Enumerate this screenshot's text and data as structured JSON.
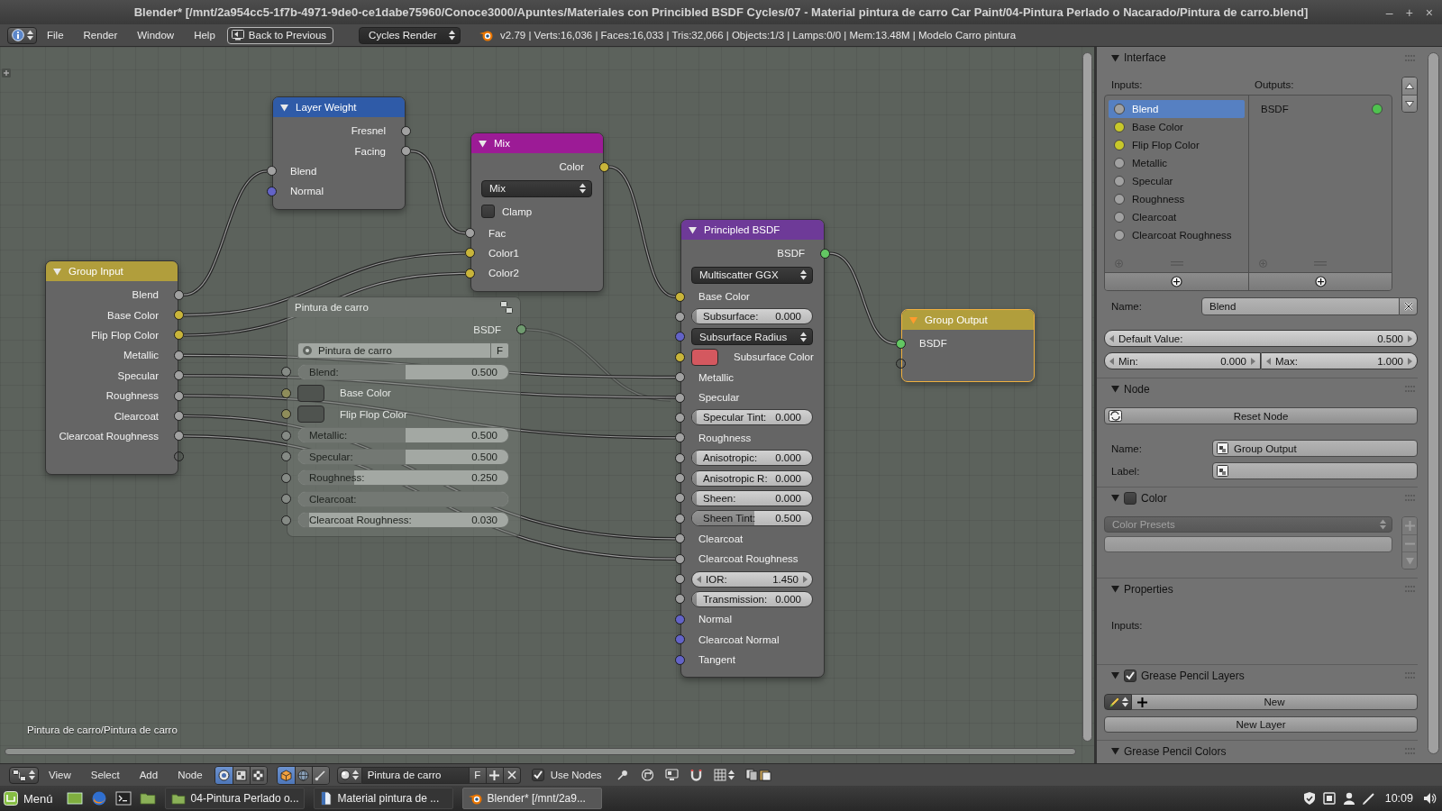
{
  "window": {
    "title": "Blender* [/mnt/2a954cc5-1f7b-4971-9de0-ce1dabe75960/Conoce3000/Apuntes/Materiales con Princibled BSDF Cycles/07 - Material pintura de carro Car Paint/04-Pintura Perlado o Nacarado/Pintura de carro.blend]",
    "controls": [
      "–",
      "+",
      "×"
    ]
  },
  "info_header": {
    "menus": [
      "File",
      "Render",
      "Window",
      "Help"
    ],
    "back_button": "Back to Previous",
    "render_engine": "Cycles Render",
    "stats": "v2.79 | Verts:16,036 | Faces:16,033 | Tris:32,066 | Objects:1/3 | Lamps:0/0 | Mem:13.48M | Modelo Carro pintura"
  },
  "node_editor": {
    "background_node": {
      "title": "Pintura de carro",
      "rows": [
        {
          "kind": "output",
          "label": "BSDF",
          "color": "#6f9a6f"
        },
        {
          "kind": "node_group",
          "label": "Pintura de carro",
          "fake_user": "F"
        },
        {
          "kind": "slider",
          "label": "Blend:",
          "value": "0.500",
          "level": 0.5,
          "color": "#858a85"
        },
        {
          "kind": "swatch",
          "label": "Base Color",
          "color": "#8f8d5a",
          "swatch": {
            "color": "#4f534f"
          }
        },
        {
          "kind": "swatch",
          "label": "Flip Flop Color",
          "color": "#8f8d5a",
          "swatch": {
            "color": "#4f534f"
          }
        },
        {
          "kind": "slider",
          "label": "Metallic:",
          "value": "0.500",
          "level": 0.5,
          "color": "#858a85"
        },
        {
          "kind": "slider",
          "label": "Specular:",
          "value": "0.500",
          "level": 0.5,
          "color": "#858a85"
        },
        {
          "kind": "slider",
          "label": "Roughness:",
          "value": "0.250",
          "level": 0.25,
          "color": "#858a85"
        },
        {
          "kind": "slider",
          "label": "Clearcoat:",
          "level": 1,
          "color": "#858a85"
        },
        {
          "kind": "slider",
          "label": "Clearcoat Roughness:",
          "value": "0.030",
          "level": 0.03,
          "color": "#858a85"
        }
      ]
    },
    "nodes": [
      {
        "title": "Layer Weight",
        "color": "#2f5ba8",
        "selected": false,
        "rows": [
          {
            "kind": "output",
            "label": "Fresnel",
            "color": "#a1a1a1"
          },
          {
            "kind": "output",
            "label": "Facing",
            "color": "#a1a1a1"
          },
          {
            "kind": "input",
            "label": "Blend",
            "color": "#a1a1a1"
          },
          {
            "kind": "input",
            "label": "Normal",
            "color": "#6363c7"
          }
        ]
      },
      {
        "title": "Mix",
        "color": "#9c1b96",
        "selected": false,
        "rows": [
          {
            "kind": "output",
            "label": "Color",
            "color": "#c9b53a"
          },
          {
            "kind": "menu",
            "label": "Mix"
          },
          {
            "kind": "checkbox",
            "label": "Clamp",
            "checked": false
          },
          {
            "kind": "input",
            "label": "Fac",
            "color": "#a1a1a1"
          },
          {
            "kind": "input",
            "label": "Color1",
            "color": "#c9b53a"
          },
          {
            "kind": "input",
            "label": "Color2",
            "color": "#c9b53a"
          }
        ]
      },
      {
        "title": "Group Input",
        "color": "#b19e3c",
        "selected": false,
        "rows": [
          {
            "kind": "output",
            "label": "Blend",
            "color": "#a1a1a1"
          },
          {
            "kind": "output",
            "label": "Base Color",
            "color": "#c9b53a"
          },
          {
            "kind": "output",
            "label": "Flip Flop Color",
            "color": "#c9b53a"
          },
          {
            "kind": "output",
            "label": "Metallic",
            "color": "#a1a1a1"
          },
          {
            "kind": "output",
            "label": "Specular",
            "color": "#a1a1a1"
          },
          {
            "kind": "output",
            "label": "Roughness",
            "color": "#a1a1a1"
          },
          {
            "kind": "output",
            "label": "Clearcoat",
            "color": "#a1a1a1"
          },
          {
            "kind": "output",
            "label": "Clearcoat Roughness",
            "color": "#a1a1a1"
          },
          {
            "kind": "empty_output"
          }
        ]
      },
      {
        "title": "Principled BSDF",
        "color": "#6e3a98",
        "selected": false,
        "rows": [
          {
            "kind": "output",
            "label": "BSDF",
            "color": "#63c763"
          },
          {
            "kind": "menu",
            "label": "Multiscatter GGX"
          },
          {
            "kind": "input",
            "label": "Base Color",
            "color": "#c9b53a"
          },
          {
            "kind": "slider",
            "label": "Subsurface:",
            "value": "0.000",
            "level": 0,
            "color": "#a1a1a1"
          },
          {
            "kind": "menu",
            "label": "Subsurface Radius",
            "color": "#6363c7"
          },
          {
            "kind": "swatch",
            "label": "Subsurface Color",
            "color": "#c9b53a",
            "swatch": {
              "color": "#d4585f"
            }
          },
          {
            "kind": "input",
            "label": "Metallic",
            "color": "#a1a1a1"
          },
          {
            "kind": "input",
            "label": "Specular",
            "color": "#a1a1a1"
          },
          {
            "kind": "slider",
            "label": "Specular Tint:",
            "value": "0.000",
            "level": 0,
            "color": "#a1a1a1"
          },
          {
            "kind": "input",
            "label": "Roughness",
            "color": "#a1a1a1"
          },
          {
            "kind": "slider",
            "label": "Anisotropic:",
            "value": "0.000",
            "level": 0,
            "color": "#a1a1a1"
          },
          {
            "kind": "slider",
            "label": "Anisotropic R:",
            "value": "0.000",
            "level": 0,
            "color": "#a1a1a1"
          },
          {
            "kind": "slider",
            "label": "Sheen:",
            "value": "0.000",
            "level": 0,
            "color": "#a1a1a1"
          },
          {
            "kind": "slider",
            "label": "Sheen Tint:",
            "value": "0.500",
            "level": 0.5,
            "color": "#a1a1a1"
          },
          {
            "kind": "input",
            "label": "Clearcoat",
            "color": "#a1a1a1"
          },
          {
            "kind": "input",
            "label": "Clearcoat Roughness",
            "color": "#a1a1a1"
          },
          {
            "kind": "number",
            "label": "IOR:",
            "value": "1.450",
            "color": "#a1a1a1"
          },
          {
            "kind": "slider",
            "label": "Transmission:",
            "value": "0.000",
            "level": 0,
            "color": "#a1a1a1"
          },
          {
            "kind": "input",
            "label": "Normal",
            "color": "#6363c7"
          },
          {
            "kind": "input",
            "label": "Clearcoat Normal",
            "color": "#6363c7"
          },
          {
            "kind": "input",
            "label": "Tangent",
            "color": "#6363c7"
          }
        ]
      },
      {
        "title": "Group Output",
        "color": "#b19e3c",
        "selected": true,
        "rows": [
          {
            "kind": "input",
            "label": "BSDF",
            "color": "#63c763"
          },
          {
            "kind": "empty_input"
          }
        ]
      }
    ],
    "breadcrumb": "Pintura de carro/Pintura de carro"
  },
  "side_panel": {
    "sections": [
      {
        "kind": "interface",
        "title": "Interface",
        "expanded": true,
        "inputs_label": "Inputs:",
        "outputs_label": "Outputs:",
        "inputs": [
          {
            "label": "Blend",
            "color": "#a1a1a1",
            "selected": true
          },
          {
            "label": "Base Color",
            "color": "#c8c82a",
            "selected": false
          },
          {
            "label": "Flip Flop Color",
            "color": "#c8c82a",
            "selected": false
          },
          {
            "label": "Metallic",
            "color": "#a1a1a1",
            "selected": false
          },
          {
            "label": "Specular",
            "color": "#a1a1a1",
            "selected": false
          },
          {
            "label": "Roughness",
            "color": "#a1a1a1",
            "selected": false
          },
          {
            "label": "Clearcoat",
            "color": "#a1a1a1",
            "selected": false
          },
          {
            "label": "Clearcoat Roughness",
            "color": "#a1a1a1",
            "selected": false
          }
        ],
        "outputs": [
          {
            "label": "BSDF",
            "color": "#4fc24f",
            "selected": false
          }
        ],
        "name_label": "Name:",
        "name_value": "Blend",
        "default_value": {
          "label": "Default Value:",
          "value": "0.500"
        },
        "min": {
          "label": "Min:",
          "value": "0.000"
        },
        "max": {
          "label": "Max:",
          "value": "1.000"
        }
      },
      {
        "kind": "node",
        "title": "Node",
        "expanded": true,
        "reset_button": "Reset Node",
        "name_label": "Name:",
        "name_value": "Group Output",
        "label_label": "Label:"
      },
      {
        "kind": "color",
        "title": "Color",
        "expanded": true,
        "checked": false,
        "presets": "Color Presets"
      },
      {
        "kind": "properties",
        "title": "Properties",
        "expanded": true,
        "inputs_label": "Inputs:"
      },
      {
        "kind": "grease_pencil_layers",
        "title": "Grease Pencil Layers",
        "expanded": true,
        "checked": true,
        "new_button": "New",
        "new_layer_button": "New Layer"
      },
      {
        "kind": "grease_pencil_colors",
        "title": "Grease Pencil Colors",
        "expanded": true
      }
    ]
  },
  "node_header": {
    "menus": [
      "View",
      "Select",
      "Add",
      "Node"
    ],
    "tree_types": [
      {
        "kind": "shader",
        "selected": true
      },
      {
        "kind": "texture",
        "selected": false
      },
      {
        "kind": "compositing",
        "selected": false
      }
    ],
    "shader_sources": [
      {
        "kind": "object",
        "selected": true
      },
      {
        "kind": "world",
        "selected": false
      },
      {
        "kind": "line_style",
        "selected": false
      }
    ],
    "material": "Pintura de carro",
    "fake_user": "F",
    "use_nodes": {
      "label": "Use Nodes",
      "checked": true
    }
  },
  "taskbar": {
    "menu": "Menú",
    "tasks": [
      {
        "kind": "folder",
        "label": "04-Pintura Perlado o...",
        "selected": false
      },
      {
        "kind": "document",
        "label": "Material pintura de ...",
        "selected": false
      },
      {
        "kind": "app",
        "label": "Blender* [/mnt/2a9...",
        "selected": true
      }
    ],
    "clock": "10:09"
  }
}
